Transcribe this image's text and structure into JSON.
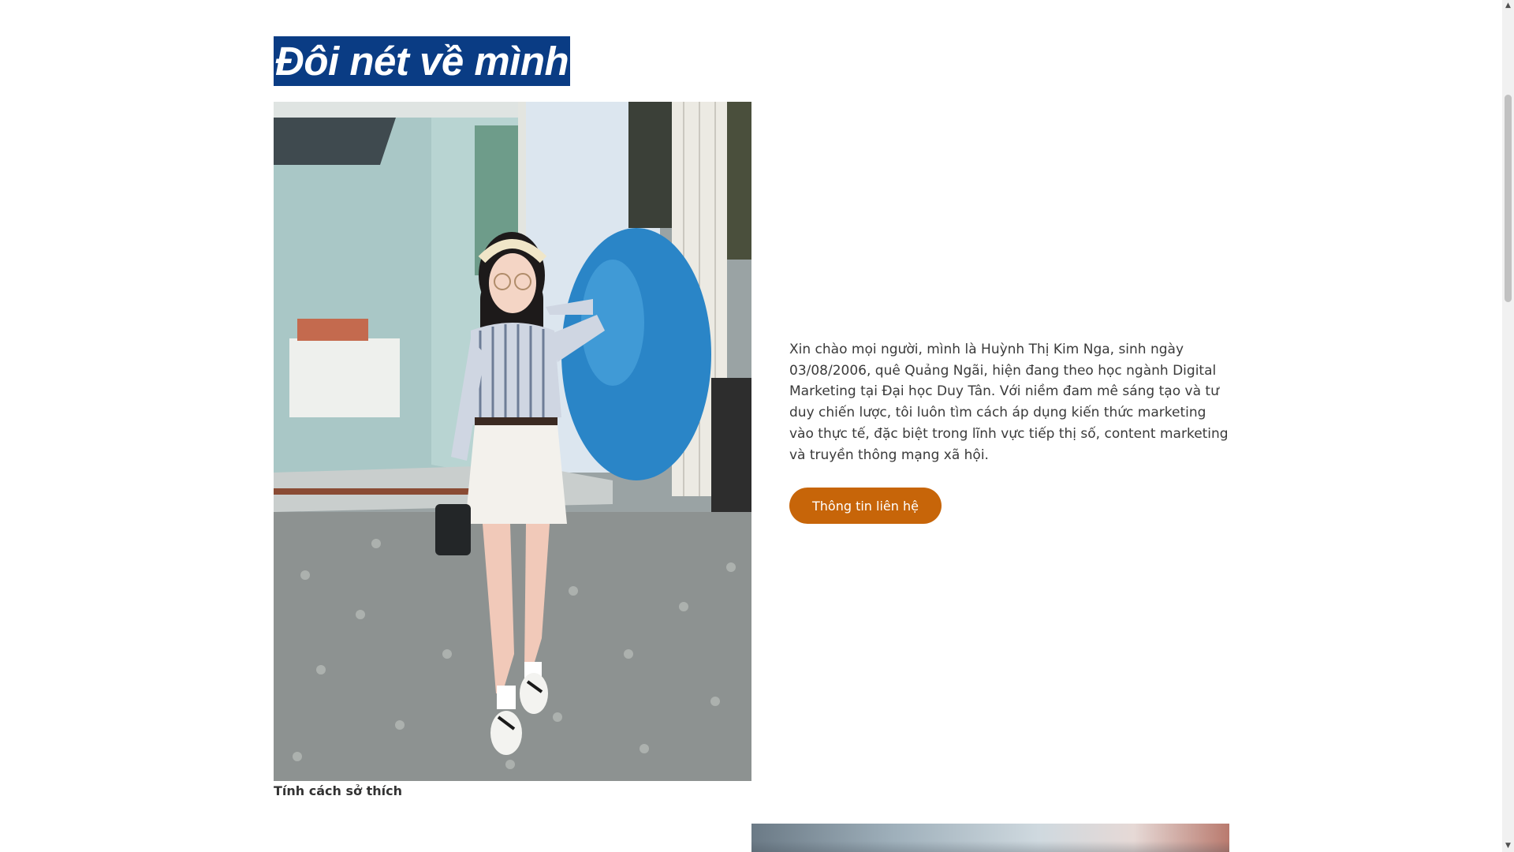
{
  "about": {
    "heading": "Đôi nét về mình",
    "photo_alt": "Tính cách sở thích",
    "caption": "Tính cách sở thích",
    "intro_text": "Xin chào mọi người, mình là Huỳnh Thị Kim Nga, sinh ngày 03/08/2006, quê Quảng Ngãi, hiện đang theo học ngành Digital Marketing tại Đại học Duy Tân. Với niềm đam mê sáng tạo và tư duy chiến lược, tôi luôn tìm cách áp dụng kiến thức marketing vào thực tế, đặc biệt trong lĩnh vực tiếp thị số, content marketing và truyền thông mạng xã hội.",
    "contact_button": "Thông tin liên hệ"
  },
  "colors": {
    "heading_bg": "#0a3c84",
    "button_bg": "#c76509",
    "text": "#3a3a3a"
  },
  "scrollbar": {
    "up_icon": "▲",
    "down_icon": "▼"
  }
}
